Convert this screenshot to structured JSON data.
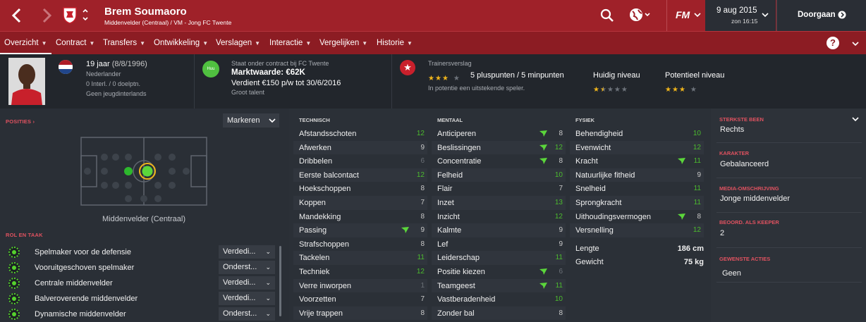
{
  "header": {
    "player_name": "Brem Soumaoro",
    "subtitle": "Middenvelder (Centraal) / VM - Jong FC Twente",
    "game_logo": "FM",
    "date": "9 aug 2015",
    "time": "zon 16:15",
    "continue_label": "Doorgaan"
  },
  "nav": {
    "tabs": [
      {
        "label": "Overzicht"
      },
      {
        "label": "Contract"
      },
      {
        "label": "Transfers"
      },
      {
        "label": "Ontwikkeling"
      },
      {
        "label": "Verslagen"
      },
      {
        "label": "Interactie"
      },
      {
        "label": "Vergelijken"
      },
      {
        "label": "Historie"
      }
    ]
  },
  "info": {
    "age": "19 jaar",
    "dob": "(8/8/1996)",
    "nationality": "Nederlander",
    "caps": "0 Interl. / 0 doelptn.",
    "youth_caps": "Geen jeugdinterlands",
    "club_badge": "Huu",
    "contract_text": "Staat onder contract bij FC Twente",
    "value": "Marktwaarde: €62K",
    "wage": "Verdient €150 p/w tot 30/6/2016",
    "talent": "Groot talent",
    "report_title": "Trainersverslag",
    "report_summary": "5 pluspunten / 5 minpunten",
    "report_potential": "In potentie een uitstekende speler.",
    "current_label": "Huidig niveau",
    "potential_label": "Potentieel niveau",
    "report_stars": 3,
    "current_stars": 1.5,
    "potential_stars": 3
  },
  "left": {
    "positions_title": "POSITIES",
    "markeren": "Markeren",
    "position_label": "Middenvelder (Centraal)",
    "role_title": "ROL EN TAAK",
    "roles": [
      {
        "name": "Spelmaker voor de defensie",
        "duty": "Verdedi..."
      },
      {
        "name": "Vooruitgeschoven spelmaker",
        "duty": "Onderst..."
      },
      {
        "name": "Centrale middenvelder",
        "duty": "Verdedi..."
      },
      {
        "name": "Balveroverende middenvelder",
        "duty": "Verdedi..."
      },
      {
        "name": "Dynamische middenvelder",
        "duty": "Onderst..."
      }
    ]
  },
  "technical": {
    "title": "TECHNISCH",
    "attrs": [
      {
        "name": "Afstandsschoten",
        "value": "12"
      },
      {
        "name": "Afwerken",
        "value": "9"
      },
      {
        "name": "Dribbelen",
        "value": "6"
      },
      {
        "name": "Eerste balcontact",
        "value": "12"
      },
      {
        "name": "Hoekschoppen",
        "value": "8"
      },
      {
        "name": "Koppen",
        "value": "7"
      },
      {
        "name": "Mandekking",
        "value": "8"
      },
      {
        "name": "Passing",
        "value": "9"
      },
      {
        "name": "Strafschoppen",
        "value": "8"
      },
      {
        "name": "Tackelen",
        "value": "11"
      },
      {
        "name": "Techniek",
        "value": "12"
      },
      {
        "name": "Verre inworpen",
        "value": "1"
      },
      {
        "name": "Voorzetten",
        "value": "7"
      },
      {
        "name": "Vrije trappen",
        "value": "8"
      }
    ]
  },
  "mental": {
    "title": "MENTAAL",
    "attrs": [
      {
        "name": "Anticiperen",
        "value": "8"
      },
      {
        "name": "Beslissingen",
        "value": "12"
      },
      {
        "name": "Concentratie",
        "value": "8"
      },
      {
        "name": "Felheid",
        "value": "10"
      },
      {
        "name": "Flair",
        "value": "7"
      },
      {
        "name": "Inzet",
        "value": "13"
      },
      {
        "name": "Inzicht",
        "value": "12"
      },
      {
        "name": "Kalmte",
        "value": "9"
      },
      {
        "name": "Lef",
        "value": "9"
      },
      {
        "name": "Leiderschap",
        "value": "11"
      },
      {
        "name": "Positie kiezen",
        "value": "6"
      },
      {
        "name": "Teamgeest",
        "value": "11"
      },
      {
        "name": "Vastberadenheid",
        "value": "10"
      },
      {
        "name": "Zonder bal",
        "value": "8"
      }
    ]
  },
  "physical": {
    "title": "FYSIEK",
    "attrs": [
      {
        "name": "Behendigheid",
        "value": "10"
      },
      {
        "name": "Evenwicht",
        "value": "12"
      },
      {
        "name": "Kracht",
        "value": "11"
      },
      {
        "name": "Natuurlijke fitheid",
        "value": "9"
      },
      {
        "name": "Snelheid",
        "value": "11"
      },
      {
        "name": "Sprongkracht",
        "value": "11"
      },
      {
        "name": "Uithoudingsvermogen",
        "value": "8"
      },
      {
        "name": "Versnelling",
        "value": "12"
      }
    ],
    "height_label": "Lengte",
    "height": "186 cm",
    "weight_label": "Gewicht",
    "weight": "75 kg"
  },
  "right": {
    "foot_title": "STERKSTE BEEN",
    "foot": "Rechts",
    "char_title": "KARAKTER",
    "char": "Gebalanceerd",
    "media_title": "MEDIA-OMSCHRIJVING",
    "media": "Jonge middenvelder",
    "keeper_title": "BEOORD. ALS KEEPER",
    "keeper": "2",
    "pref_title": "GEWENSTE ACTIES",
    "pref": "Geen"
  }
}
